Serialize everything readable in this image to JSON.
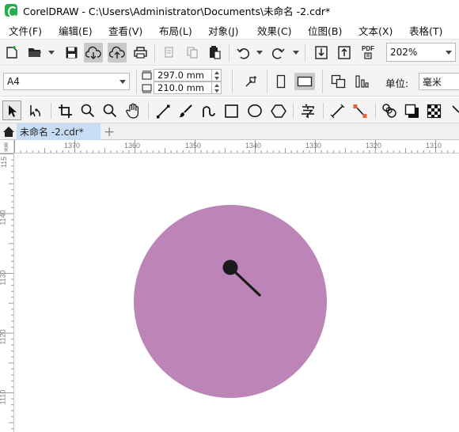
{
  "window": {
    "title": "CorelDRAW - C:\\Users\\Administrator\\Documents\\未命名 -2.cdr*"
  },
  "menu": [
    {
      "label": "文件(F)"
    },
    {
      "label": "编辑(E)"
    },
    {
      "label": "查看(V)"
    },
    {
      "label": "布局(L)"
    },
    {
      "label": "对象(J)"
    },
    {
      "label": "效果(C)"
    },
    {
      "label": "位图(B)"
    },
    {
      "label": "文本(X)"
    },
    {
      "label": "表格(T)"
    }
  ],
  "standard_toolbar": {
    "zoom_value": "202%",
    "pdf_label": "PDF"
  },
  "property_bar": {
    "page_size": "A4",
    "width": "297.0 mm",
    "height": "210.0 mm",
    "units_label": "单位:",
    "units_value": "毫米"
  },
  "document_tab": {
    "label": "未命名 -2.cdr*",
    "add_label": "+"
  },
  "ruler": {
    "horizontal": [
      "1370",
      "1360",
      "1350",
      "1340",
      "1330",
      "1320",
      "1310"
    ],
    "vertical": [
      "115",
      "1140",
      "1130",
      "1120",
      "1110"
    ],
    "corner_unit": "毫米"
  },
  "canvas": {
    "circle_fill": "#bc84b7",
    "dot_color": "#1a1a1a"
  }
}
